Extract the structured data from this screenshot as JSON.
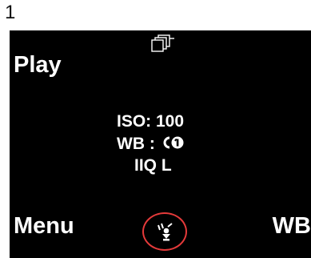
{
  "page_number": "1",
  "screen": {
    "top_icon": "stacked-images-icon",
    "softkeys": {
      "top_left": "Play",
      "bottom_left": "Menu",
      "bottom_right": "WB"
    },
    "info": {
      "iso": "ISO: 100",
      "wb_prefix": "WB :",
      "wb_mode_icon": "custom-white-balance-1-icon",
      "format": "IIQ L"
    },
    "status_icon": "firewire-connection-icon",
    "highlight_color": "#e53a3a"
  }
}
